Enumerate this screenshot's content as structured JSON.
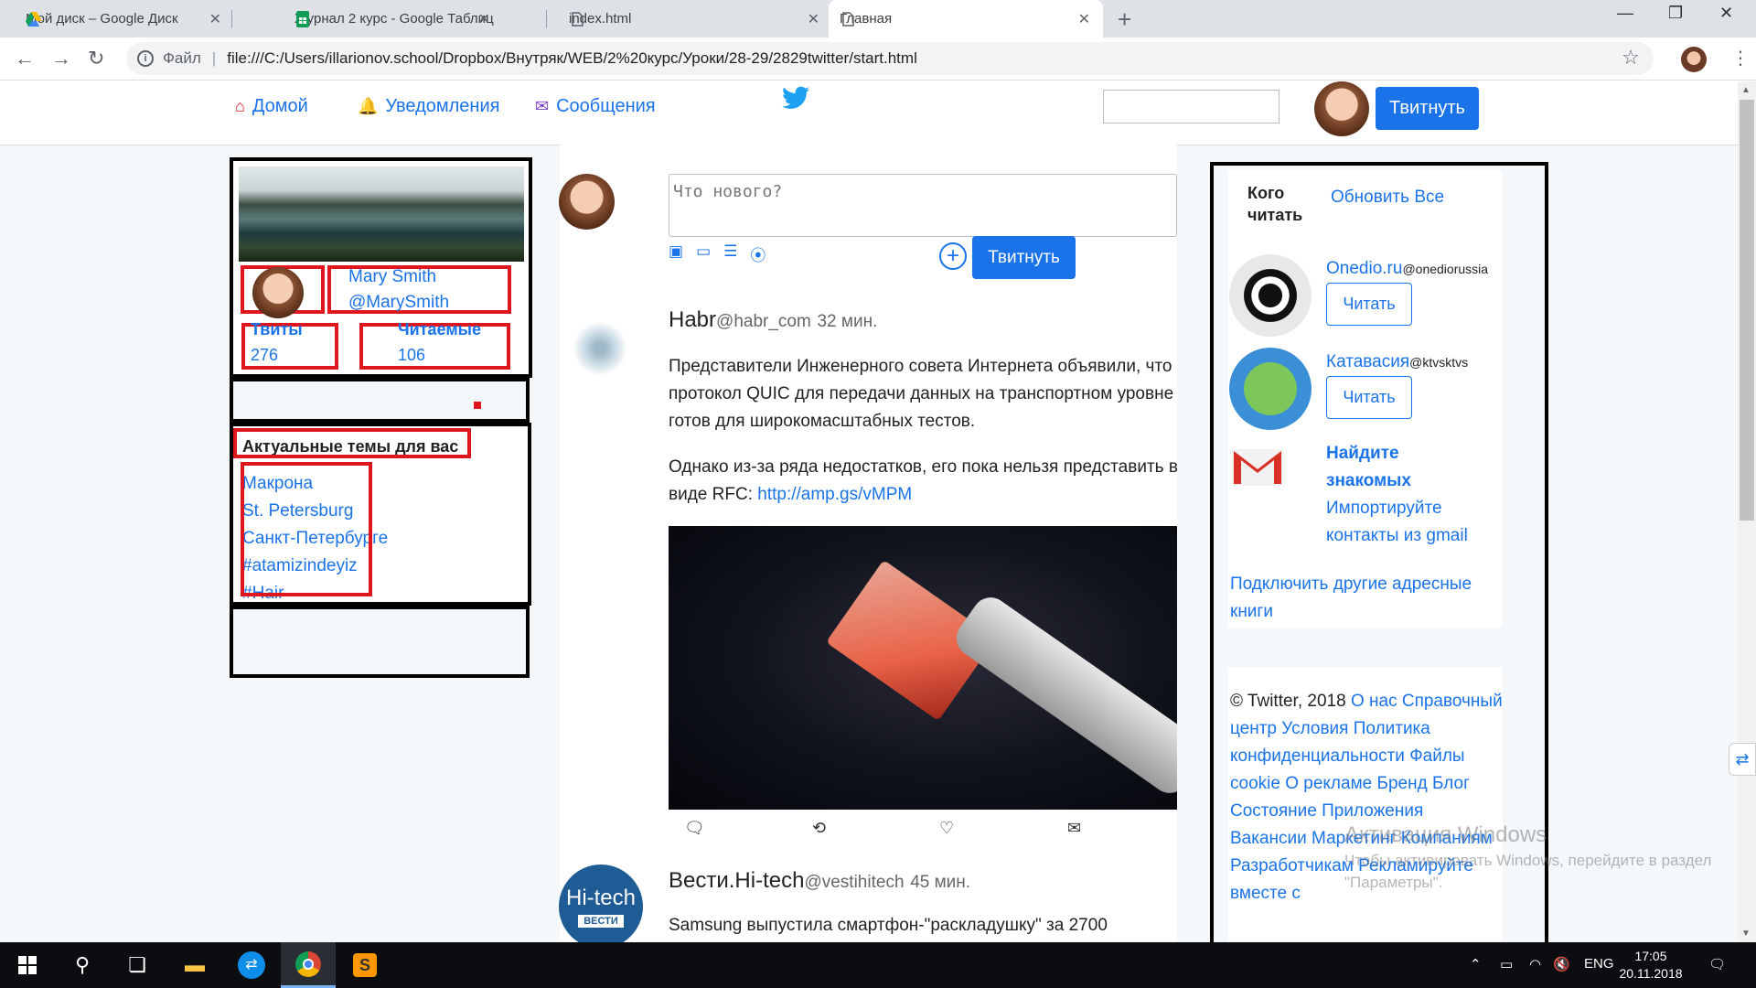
{
  "browser": {
    "tabs": [
      {
        "title": "Мой диск – Google Диск",
        "icon": "google-drive-icon",
        "active": false
      },
      {
        "title": "Журнал 2 курс - Google Таблиц",
        "icon": "google-sheets-icon",
        "active": false
      },
      {
        "title": "index.html",
        "icon": "file-icon",
        "active": false
      },
      {
        "title": "Главная",
        "icon": "file-icon",
        "active": true
      }
    ],
    "address_label": "Файл",
    "url": "file:///C:/Users/illarionov.school/Dropbox/Внутряк/WEB/2%20курс/Уроки/28-29/2829twitter/start.html"
  },
  "nav": {
    "home": "Домой",
    "notifications": "Уведомления",
    "messages": "Сообщения",
    "tweet_button": "Твитнуть"
  },
  "profile": {
    "name": "Mary Smith",
    "handle": "@MarySmith",
    "tweets_label": "Твиты",
    "tweets_count": "276",
    "following_label": "Читаемые",
    "following_count": "106"
  },
  "trends": {
    "title": "Актуальные темы для вас",
    "items": [
      "Макрона",
      "St. Petersburg",
      "Санкт-Петербурге",
      "#atamizindeyiz",
      "#Hair"
    ]
  },
  "compose": {
    "placeholder": "Что нового?",
    "button": "Твитнуть"
  },
  "tweets": [
    {
      "author": "Habr",
      "handle": "@habr_com",
      "time": "32 мин.",
      "para1": "Представители Инженерного совета Интернета объявили, что протокол QUIC для передачи данных на транспортном уровне готов для широкомасштабных тестов.",
      "para2": "Однако из-за ряда недостатков, его пока нельзя представить в виде RFC:",
      "link": "http://amp.gs/vMPM"
    },
    {
      "author": "Вести.Hi-tech",
      "handle": "@vestihitech",
      "time": "45 мин.",
      "para1": "Samsung выпустила смартфон-\"раскладушку\" за 2700",
      "logo_top": "Hi-tech",
      "logo_bottom": "ВЕСТИ"
    }
  ],
  "who_to_follow": {
    "title_line1": "Кого",
    "title_line2": "читать",
    "refresh": "Обновить",
    "all": "Все",
    "accounts": [
      {
        "name": "Onedio.ru",
        "handle": "@onediorussia",
        "button": "Читать"
      },
      {
        "name": "Катавасия",
        "handle": "@ktvsktvs",
        "button": "Читать"
      }
    ],
    "find_title_1": "Найдите",
    "find_title_2": "знакомых",
    "find_text_1": "Импортируйте",
    "find_text_2": "контакты из gmail",
    "connect_1": "Подключить другие адресные",
    "connect_2": "книги"
  },
  "footer": {
    "copyright": "© Twitter, 2018",
    "links": [
      "О нас",
      "Справочный центр",
      "Условия",
      "Политика конфиденциальности",
      "Файлы cookie",
      "О рекламе",
      "Бренд",
      "Блог",
      "Состояние",
      "Приложения",
      "Вакансии",
      "Маркетинг",
      "Компаниям",
      "Разработчикам",
      "Рекламируйте вместе с"
    ]
  },
  "watermark": {
    "line1": "Активация Windows",
    "line2": "Чтобы активировать Windows, перейдите в раздел",
    "line3": "\"Параметры\"."
  },
  "taskbar": {
    "lang": "ENG",
    "time": "17:05",
    "date": "20.11.2018"
  },
  "colors": {
    "accent": "#1a73e8",
    "twitter_blue": "#1da1f2",
    "highlight_red": "#e0161e"
  }
}
